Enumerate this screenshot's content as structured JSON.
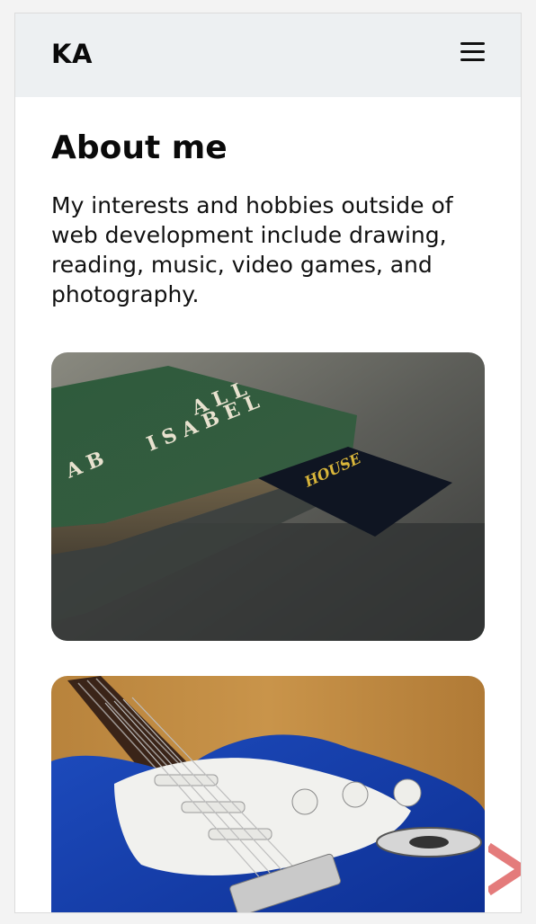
{
  "header": {
    "logo_text": "KA",
    "menu_icon": "hamburger-menu-icon"
  },
  "main": {
    "title": "About me",
    "intro": "My interests and hobbies outside of web development include drawing, reading, music, video games, and photography."
  },
  "photos": [
    {
      "subject": "book-with-bookmark-photo",
      "book_title_letters": "ISABELLA",
      "bookmark_text": "HOUSE"
    },
    {
      "subject": "blue-electric-guitar-photo"
    }
  ],
  "colors": {
    "header_bg": "#edf0f2",
    "page_bg": "#ffffff",
    "text": "#0a0a0a",
    "accent_deco": "#e47b7b"
  }
}
